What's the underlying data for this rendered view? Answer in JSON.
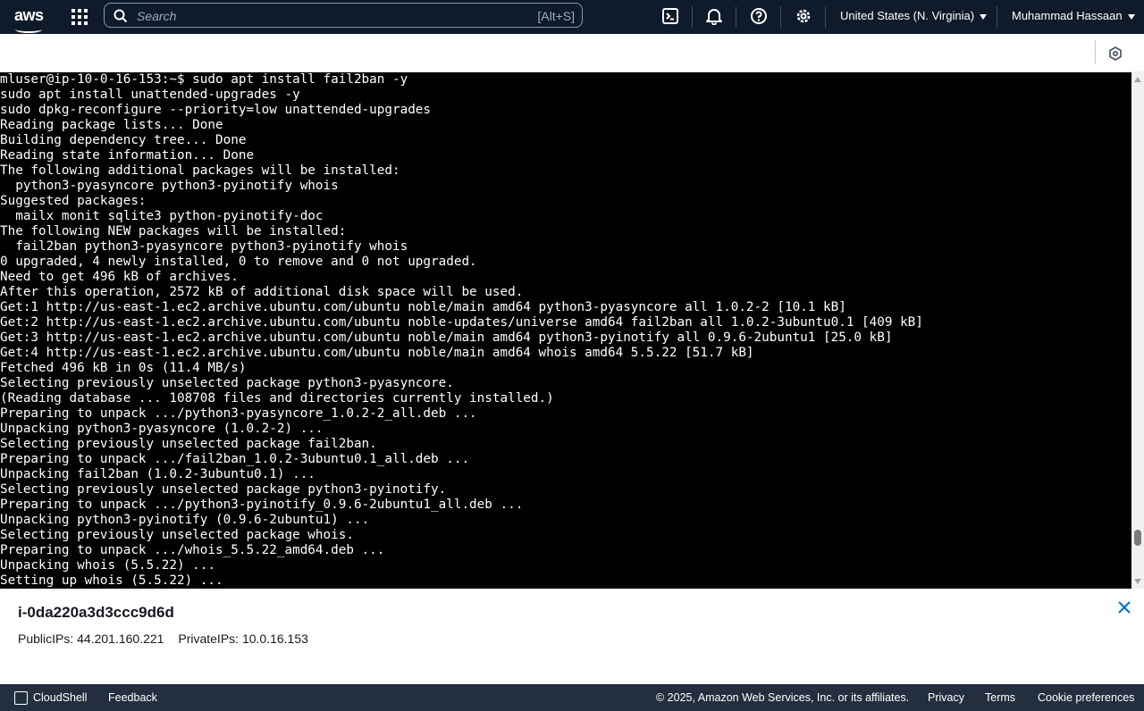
{
  "topnav": {
    "logo": "aws",
    "search_placeholder": "Search",
    "search_shortcut": "[Alt+S]",
    "region": "United States (N. Virginia)",
    "user": "Muhammad Hassaan",
    "icons": [
      "services-grid-icon",
      "search-icon",
      "cloudshell-icon",
      "bell-icon",
      "help-icon",
      "gear-icon"
    ]
  },
  "terminal": {
    "lines": [
      "mluser@ip-10-0-16-153:~$ sudo apt install fail2ban -y",
      "sudo apt install unattended-upgrades -y",
      "sudo dpkg-reconfigure --priority=low unattended-upgrades",
      "Reading package lists... Done",
      "Building dependency tree... Done",
      "Reading state information... Done",
      "The following additional packages will be installed:",
      "  python3-pyasyncore python3-pyinotify whois",
      "Suggested packages:",
      "  mailx monit sqlite3 python-pyinotify-doc",
      "The following NEW packages will be installed:",
      "  fail2ban python3-pyasyncore python3-pyinotify whois",
      "0 upgraded, 4 newly installed, 0 to remove and 0 not upgraded.",
      "Need to get 496 kB of archives.",
      "After this operation, 2572 kB of additional disk space will be used.",
      "Get:1 http://us-east-1.ec2.archive.ubuntu.com/ubuntu noble/main amd64 python3-pyasyncore all 1.0.2-2 [10.1 kB]",
      "Get:2 http://us-east-1.ec2.archive.ubuntu.com/ubuntu noble-updates/universe amd64 fail2ban all 1.0.2-3ubuntu0.1 [409 kB]",
      "Get:3 http://us-east-1.ec2.archive.ubuntu.com/ubuntu noble/main amd64 python3-pyinotify all 0.9.6-2ubuntu1 [25.0 kB]",
      "Get:4 http://us-east-1.ec2.archive.ubuntu.com/ubuntu noble/main amd64 whois amd64 5.5.22 [51.7 kB]",
      "Fetched 496 kB in 0s (11.4 MB/s)",
      "Selecting previously unselected package python3-pyasyncore.",
      "(Reading database ... 108708 files and directories currently installed.)",
      "Preparing to unpack .../python3-pyasyncore_1.0.2-2_all.deb ...",
      "Unpacking python3-pyasyncore (1.0.2-2) ...",
      "Selecting previously unselected package fail2ban.",
      "Preparing to unpack .../fail2ban_1.0.2-3ubuntu0.1_all.deb ...",
      "Unpacking fail2ban (1.0.2-3ubuntu0.1) ...",
      "Selecting previously unselected package python3-pyinotify.",
      "Preparing to unpack .../python3-pyinotify_0.9.6-2ubuntu1_all.deb ...",
      "Unpacking python3-pyinotify (0.9.6-2ubuntu1) ...",
      "Selecting previously unselected package whois.",
      "Preparing to unpack .../whois_5.5.22_amd64.deb ...",
      "Unpacking whois (5.5.22) ...",
      "Setting up whois (5.5.22) ..."
    ]
  },
  "instance": {
    "id": "i-0da220a3d3ccc9d6d",
    "public_ips": "PublicIPs: 44.201.160.221",
    "private_ips": "PrivateIPs: 10.0.16.153"
  },
  "footer": {
    "cloudshell": "CloudShell",
    "feedback": "Feedback",
    "copyright": "© 2025, Amazon Web Services, Inc. or its affiliates.",
    "privacy": "Privacy",
    "terms": "Terms",
    "cookies": "Cookie preferences"
  },
  "colors": {
    "nav_bg": "#0f1b2a",
    "terminal_bg": "#000000",
    "terminal_fg": "#ffffff",
    "footer_bg": "#232f3e",
    "close_icon": "#0972d3"
  }
}
